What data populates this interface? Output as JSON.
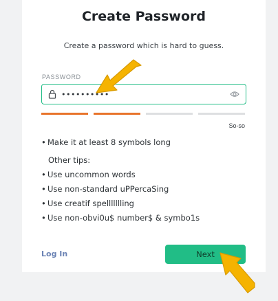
{
  "title": "Create Password",
  "subtitle": "Create a password which is hard to guess.",
  "password": {
    "label": "PASSWORD",
    "value": "••••••••••",
    "lock_icon": "lock-icon",
    "visibility_icon": "eye-icon"
  },
  "strength": {
    "label": "So-so",
    "filled_segments": 2,
    "total_segments": 4,
    "filled_color": "#e8742b",
    "empty_color": "#dddfe1"
  },
  "rules": {
    "main": "Make it at least 8 symbols long",
    "tips_heading": "Other tips:",
    "tips": [
      "Use uncommon words",
      "Use non-standard uPPercaSing",
      "Use creatif spellllllling",
      "Use non-obvi0u$ number$ & symbo1s"
    ]
  },
  "footer": {
    "login_label": "Log In",
    "next_label": "Next"
  },
  "colors": {
    "accent": "#21bd86",
    "link": "#6c84b5",
    "arrow": "#f5b301"
  }
}
